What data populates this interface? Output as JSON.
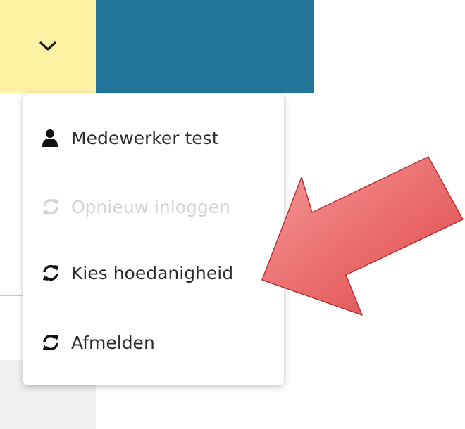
{
  "topbar": {
    "toggle_icon": "chevron-down-icon",
    "yellow_color": "#fdf1a4",
    "blue_color": "#23769a"
  },
  "menu": {
    "items": [
      {
        "label": "Medewerker test",
        "icon": "user-icon",
        "enabled": true
      },
      {
        "label": "Opnieuw inloggen",
        "icon": "refresh-icon",
        "enabled": false
      },
      {
        "label": "Kies hoedanigheid",
        "icon": "refresh-icon",
        "enabled": true
      },
      {
        "label": "Afmelden",
        "icon": "refresh-icon",
        "enabled": true
      }
    ]
  },
  "annotation": {
    "icon": "red-arrow-pointer",
    "color": "#e8565a"
  }
}
